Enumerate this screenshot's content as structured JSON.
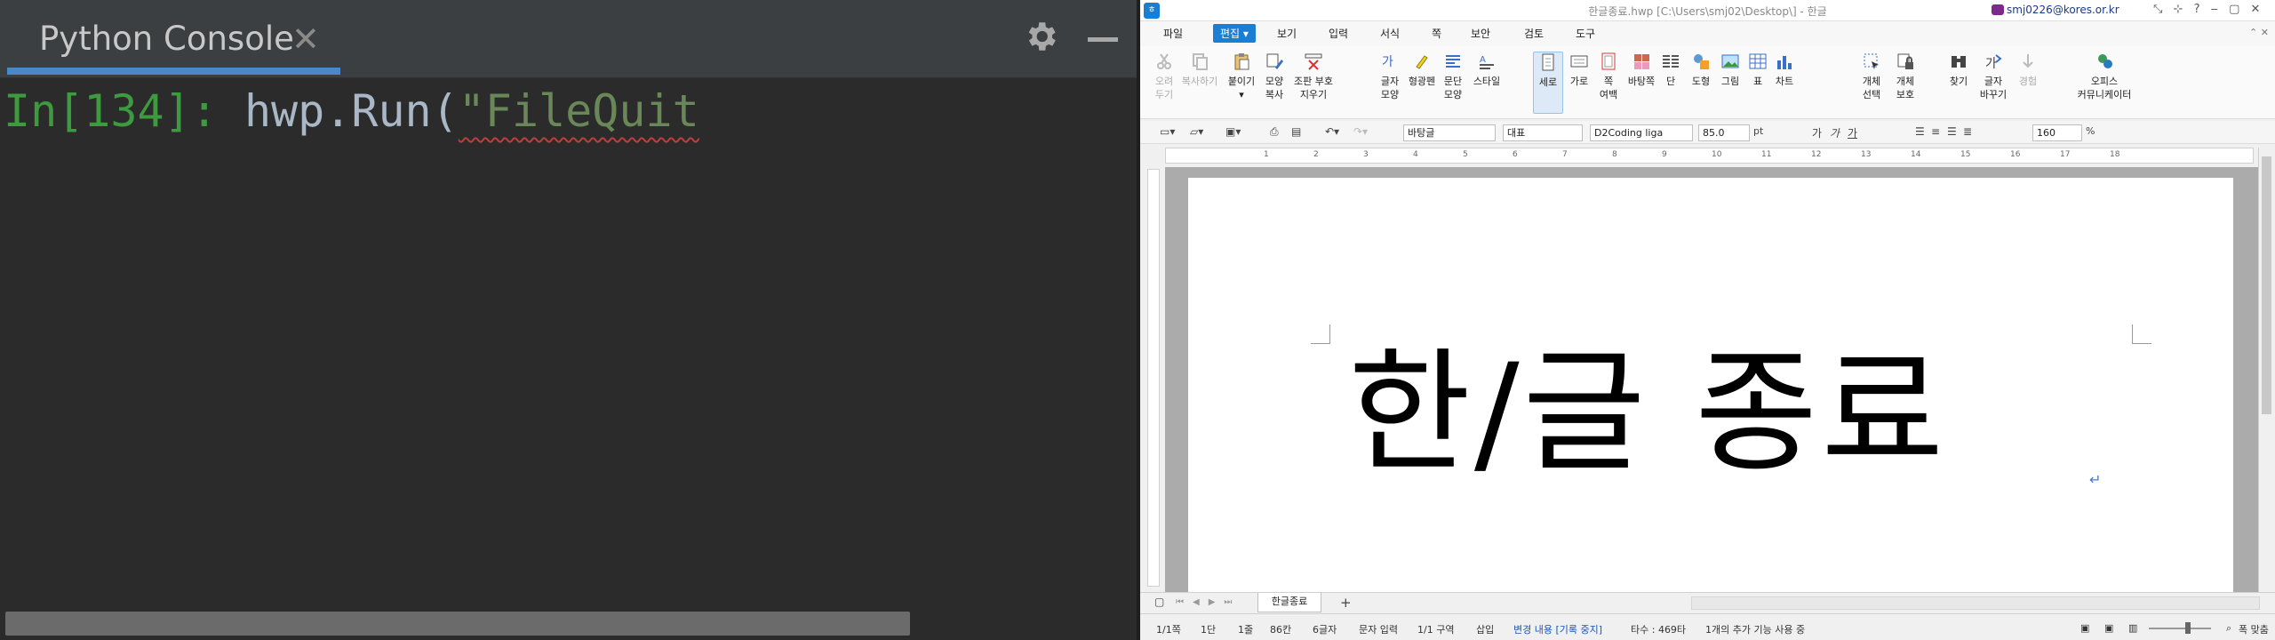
{
  "console": {
    "tab_label": "Python Console",
    "close_glyph": "✕",
    "gear_icon": "gear-icon",
    "prompt": "In[134]: ",
    "code": "hwp.Run(",
    "string": "\"FileQuit",
    "colors": {
      "bg": "#2b2b2b",
      "prompt": "#3e9a3e",
      "code": "#a9b7c6",
      "string": "#6a8759",
      "accent": "#4a88c7"
    }
  },
  "hwp": {
    "title": "한글종료.hwp [C:\\Users\\smj02\\Desktop\\] - 한글",
    "user": "smj0226@kores.or.kr",
    "window_controls": [
      "⤡",
      "⊹",
      "?",
      "‒",
      "▢",
      "✕"
    ],
    "menu": {
      "file": "파일",
      "edit": "편집",
      "items": [
        "보기",
        "입력",
        "서식",
        "쪽",
        "보안",
        "검토",
        "도구"
      ],
      "right": "⌃ ✕"
    },
    "ribbon": {
      "cut": "오려\n두기",
      "copy": "복사하기",
      "paste": "붙이기",
      "format_copy": "모양\n복사",
      "clear": "조판 부호\n지우기",
      "char_shape": "글자\n모양",
      "highlight": "형광펜",
      "para_shape": "문단\n모양",
      "style": "스타일",
      "portrait": "세로",
      "landscape": "가로",
      "margin": "쪽\n여백",
      "page_bg": "바탕쪽",
      "column": "단",
      "shape": "도형",
      "picture": "그림",
      "table": "표",
      "chart": "차트",
      "select_object": "개체\n선택",
      "protect_object": "개체\n보호",
      "find": "찾기",
      "replace": "글자\n바꾸기",
      "pattern": "경험",
      "office": "오피스\n커뮤니케이터"
    },
    "format": {
      "style": "바탕글",
      "lang": "대표",
      "font": "D2Coding liga",
      "size": "85.0",
      "unit": "pt",
      "zoom": "160",
      "zoom_unit": "%",
      "bold": "가",
      "italic": "가",
      "underline": "가"
    },
    "ruler_numbers": [
      "1",
      "2",
      "3",
      "4",
      "5",
      "6",
      "7",
      "8",
      "9",
      "10",
      "11",
      "12",
      "13",
      "14",
      "15",
      "16",
      "17",
      "18"
    ],
    "document_text": "한/글 종료",
    "para_mark": "↵",
    "doc_tab": "한글종료",
    "add_tab": "+",
    "status": {
      "page": "1/1쪽",
      "column": "1단",
      "line": "1줄",
      "col": "86칸",
      "chars": "6글자",
      "input": "문자 입력",
      "section": "1/1 구역",
      "insert": "삽입",
      "track": "변경 내용 [기록 중지]",
      "typing": "타수 : 469타",
      "addons": "1개의 추가 기능 사용 중",
      "fit": "폭 맞춤"
    }
  }
}
